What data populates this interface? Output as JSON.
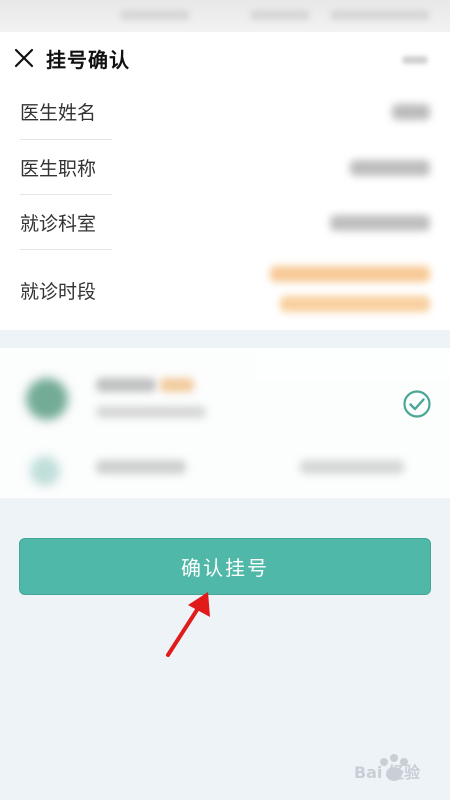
{
  "nav": {
    "title": "挂号确认"
  },
  "info_rows": [
    {
      "label": "医生姓名"
    },
    {
      "label": "医生职称"
    },
    {
      "label": "就诊科室"
    },
    {
      "label": "就诊时段"
    }
  ],
  "confirm_button": {
    "label": "确认挂号"
  },
  "colors": {
    "accent": "#4fb8a8",
    "check": "#4aa796",
    "time_slot_highlight": "#f8c996",
    "arrow": "#e11a1a"
  },
  "watermark": {
    "text": "Bai 经验"
  }
}
